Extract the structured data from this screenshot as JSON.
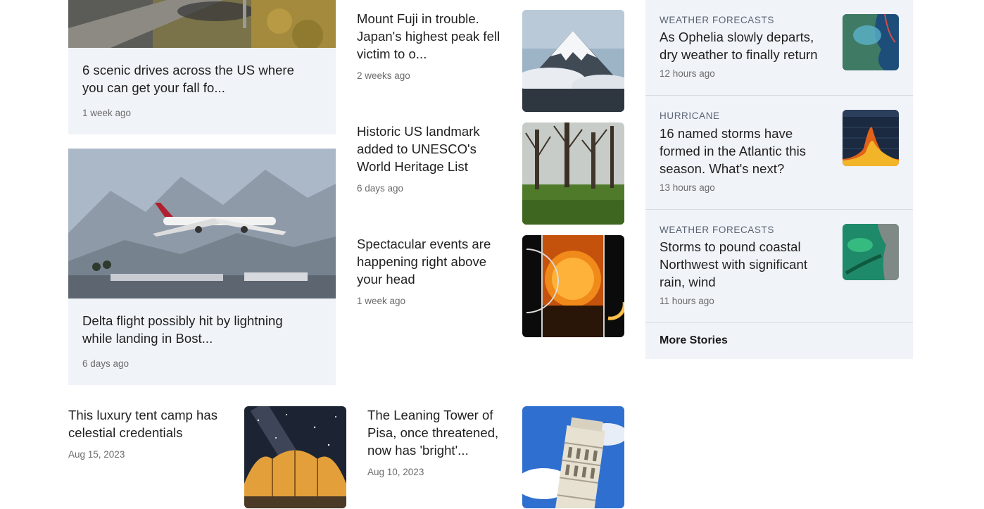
{
  "left_cards": [
    {
      "title": "6 scenic drives across the US where you can get your fall fo...",
      "time": "1 week ago"
    },
    {
      "title": "Delta flight possibly hit by lightning while landing in Bost...",
      "time": "6 days ago"
    }
  ],
  "middle_items": [
    {
      "title": "Mount Fuji in trouble. Japan's highest peak fell victim to o...",
      "time": "2 weeks ago"
    },
    {
      "title": "Historic US landmark added to UNESCO's World Heritage List",
      "time": "6 days ago"
    },
    {
      "title": "Spectacular events are happening right above your head",
      "time": "1 week ago"
    }
  ],
  "bottom_items": [
    {
      "title": "This luxury tent camp has celestial credentials",
      "time": "Aug 15, 2023"
    },
    {
      "title": "The Leaning Tower of Pisa, once threatened, now has 'bright'...",
      "time": "Aug 10, 2023"
    }
  ],
  "sidebar": {
    "items": [
      {
        "category": "WEATHER FORECASTS",
        "title": "As Ophelia slowly departs, dry weather to finally return",
        "time": "12 hours ago"
      },
      {
        "category": "HURRICANE",
        "title": "16 named storms have formed in the Atlantic this season. What's next?",
        "time": "13 hours ago"
      },
      {
        "category": "WEATHER FORECASTS",
        "title": "Storms to pound coastal Northwest with significant rain, wind",
        "time": "11 hours ago"
      }
    ],
    "more_label": "More Stories"
  },
  "colors": {
    "card_bg": "#f0f3f8",
    "divider": "#d8dde5",
    "text": "#1f1f1f",
    "muted": "#6b6b6b"
  }
}
